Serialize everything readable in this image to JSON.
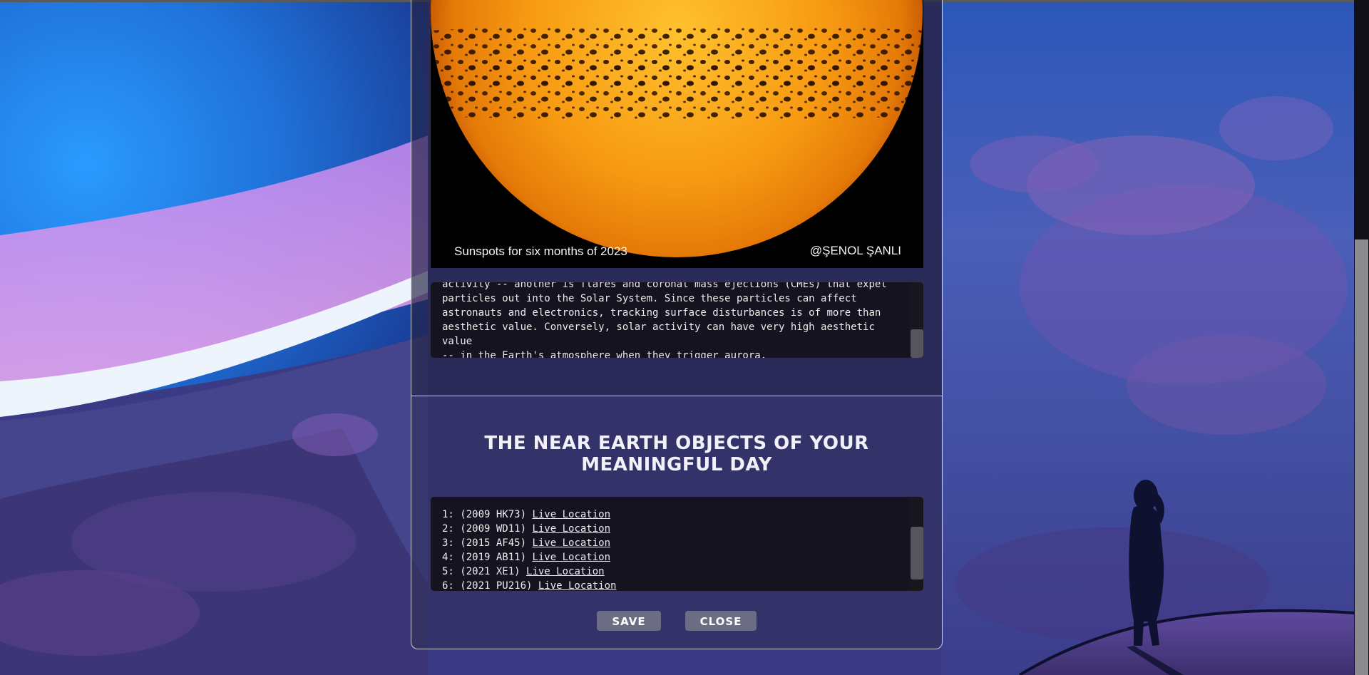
{
  "apod": {
    "image_caption": "Sunspots for six months of 2023",
    "image_credit": "@ŞENOL ŞANLI",
    "explanation": "activity -- another is flares and coronal mass ejections (CMEs) that expel\nparticles out into the Solar System. Since these particles can affect\nastronauts and electronics, tracking surface disturbances is of more than\naesthetic value. Conversely, solar activity can have very high aesthetic value\n-- in the Earth's atmosphere when they trigger aurora."
  },
  "neo": {
    "title": "THE NEAR EARTH OBJECTS OF YOUR MEANINGFUL DAY",
    "link_label": "Live Location",
    "items": [
      {
        "prefix": "1: (2009 HK73) ",
        "link": "Live Location"
      },
      {
        "prefix": "2: (2009 WD11) ",
        "link": "Live Location"
      },
      {
        "prefix": "3: (2015 AF45) ",
        "link": "Live Location"
      },
      {
        "prefix": "4: (2019 AB11) ",
        "link": "Live Location"
      },
      {
        "prefix": "5: (2021 XE1) ",
        "link": "Live Location"
      },
      {
        "prefix": "6: (2021 PU216) ",
        "link": "Live Location"
      }
    ]
  },
  "buttons": {
    "save_label": "SAVE",
    "close_label": "CLOSE"
  },
  "colors": {
    "button_bg": "#6c6c83",
    "text_box_bg": "#15131f",
    "sun_orange": "#f59a10"
  }
}
